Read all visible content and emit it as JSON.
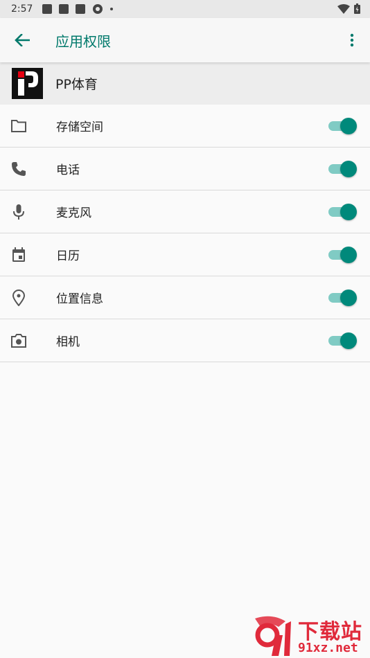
{
  "status_bar": {
    "time": "2:57"
  },
  "app_bar": {
    "title": "应用权限",
    "back_icon": "arrow-back-icon",
    "more_icon": "more-vert-icon"
  },
  "app": {
    "name": "PP体育"
  },
  "permissions": [
    {
      "label": "存储空间",
      "icon": "folder-icon",
      "enabled": true
    },
    {
      "label": "电话",
      "icon": "phone-icon",
      "enabled": true
    },
    {
      "label": "麦克风",
      "icon": "mic-icon",
      "enabled": true
    },
    {
      "label": "日历",
      "icon": "calendar-icon",
      "enabled": true
    },
    {
      "label": "位置信息",
      "icon": "location-icon",
      "enabled": true
    },
    {
      "label": "相机",
      "icon": "camera-icon",
      "enabled": true
    }
  ],
  "watermark": {
    "line1": "下载站",
    "line2": "91xz.net"
  },
  "colors": {
    "accent": "#00796b",
    "toggle_track": "#80cbc4",
    "toggle_knob": "#00897b"
  }
}
